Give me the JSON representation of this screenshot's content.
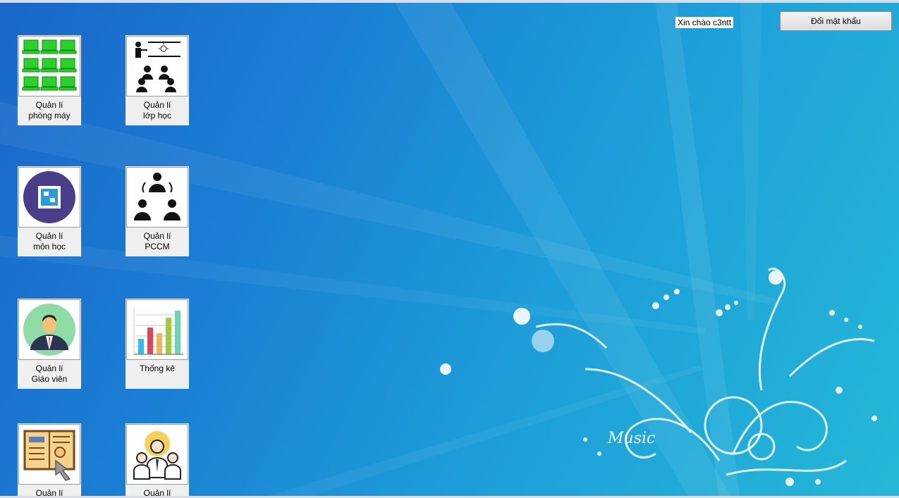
{
  "header": {
    "greeting": "Xin chào c3ntt",
    "change_password": "Đổi mật khẩu"
  },
  "tiles": [
    {
      "line1": "Quản lí",
      "line2": "phòng máy",
      "icon": "computer-lab-icon"
    },
    {
      "line1": "Quản lí",
      "line2": "lớp học",
      "icon": "classroom-icon"
    },
    {
      "line1": "Quản lí",
      "line2": "môn học",
      "icon": "subject-icon"
    },
    {
      "line1": "Quản lí",
      "line2": "PCCM",
      "icon": "assignment-icon"
    },
    {
      "line1": "Quản lí",
      "line2": "Giáo viên",
      "icon": "teacher-icon"
    },
    {
      "line1": "Thống kê",
      "line2": "",
      "icon": "statistics-chart-icon"
    },
    {
      "line1": "Quản lí",
      "line2": "",
      "icon": "profile-document-icon"
    },
    {
      "line1": "Quản lí",
      "line2": "",
      "icon": "staff-group-icon"
    }
  ],
  "wallpaper": {
    "watermark_text": "Music",
    "colors": {
      "start": "#1967c9",
      "end": "#24b8d8"
    }
  }
}
